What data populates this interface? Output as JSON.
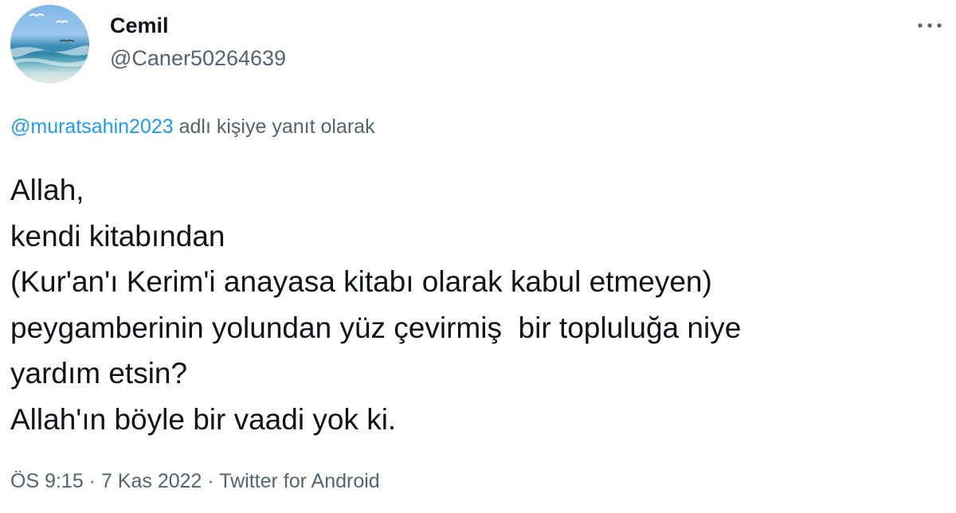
{
  "author": {
    "name": "Cemil",
    "handle": "@Caner50264639"
  },
  "reply_to": {
    "mention": "@muratsahin2023",
    "suffix": " adlı kişiye yanıt olarak"
  },
  "tweet": {
    "lines": [
      "Allah,",
      "kendi kitabından",
      "(Kur'an'ı Kerim'i anayasa kitabı olarak kabul etmeyen)",
      "peygamberinin yolundan yüz çevirmiş  bir topluluğa niye",
      "yardım etsin?",
      "Allah'ın böyle bir vaadi yok ki."
    ]
  },
  "meta": {
    "time": "ÖS 9:15",
    "sep1": " · ",
    "date": "7 Kas 2022",
    "sep2": " · ",
    "source": "Twitter for Android"
  },
  "icons": {
    "more": "more-horizontal-icon",
    "avatar": "profile-avatar"
  },
  "colors": {
    "text": "#0f1419",
    "secondary": "#536471",
    "link": "#1d9bf0"
  }
}
